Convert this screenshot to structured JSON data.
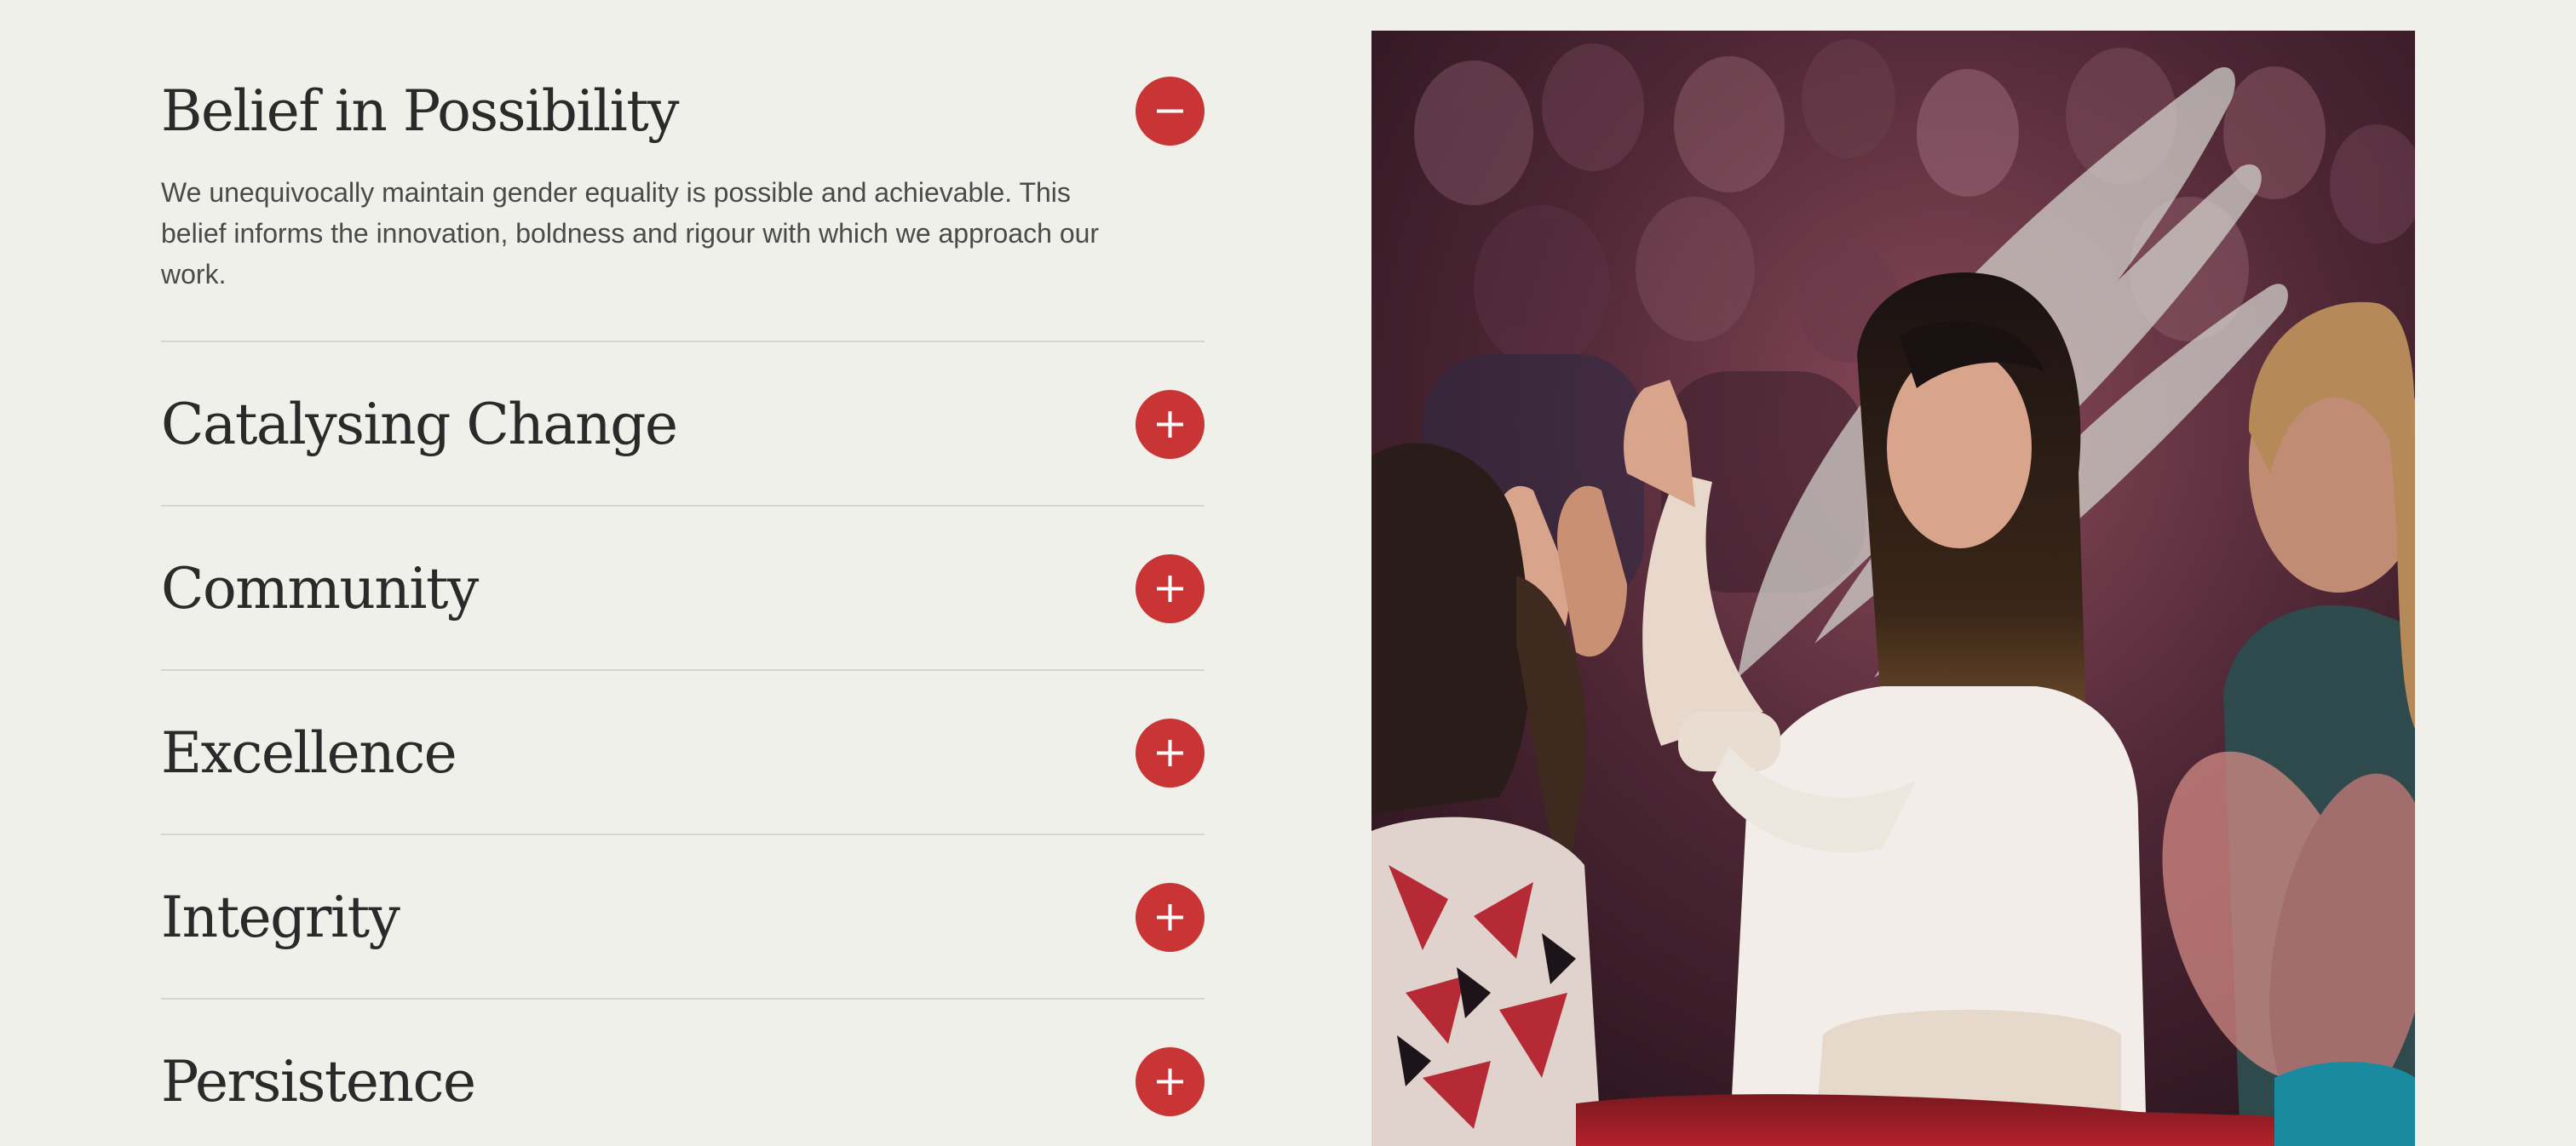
{
  "accordion": {
    "items": [
      {
        "title": "Belief in Possibility",
        "expanded": true,
        "body": "We unequivocally maintain gender equality is possible and achievable. This belief informs the innovation, boldness and rigour with which we approach our work.",
        "toggle_icon": "minus-icon"
      },
      {
        "title": "Catalysing Change",
        "expanded": false,
        "toggle_icon": "plus-icon"
      },
      {
        "title": "Community",
        "expanded": false,
        "toggle_icon": "plus-icon"
      },
      {
        "title": "Excellence",
        "expanded": false,
        "toggle_icon": "plus-icon"
      },
      {
        "title": "Integrity",
        "expanded": false,
        "toggle_icon": "plus-icon"
      },
      {
        "title": "Persistence",
        "expanded": false,
        "toggle_icon": "plus-icon"
      }
    ]
  },
  "image": {
    "subject": "audience applauding at an event",
    "overlay": "winged-logo-mark"
  },
  "colors": {
    "background": "#f0f0eb",
    "accent": "#c93535",
    "heading": "#2a2a2a",
    "body_text": "#4a4a4a",
    "divider": "#d6d6d0"
  }
}
